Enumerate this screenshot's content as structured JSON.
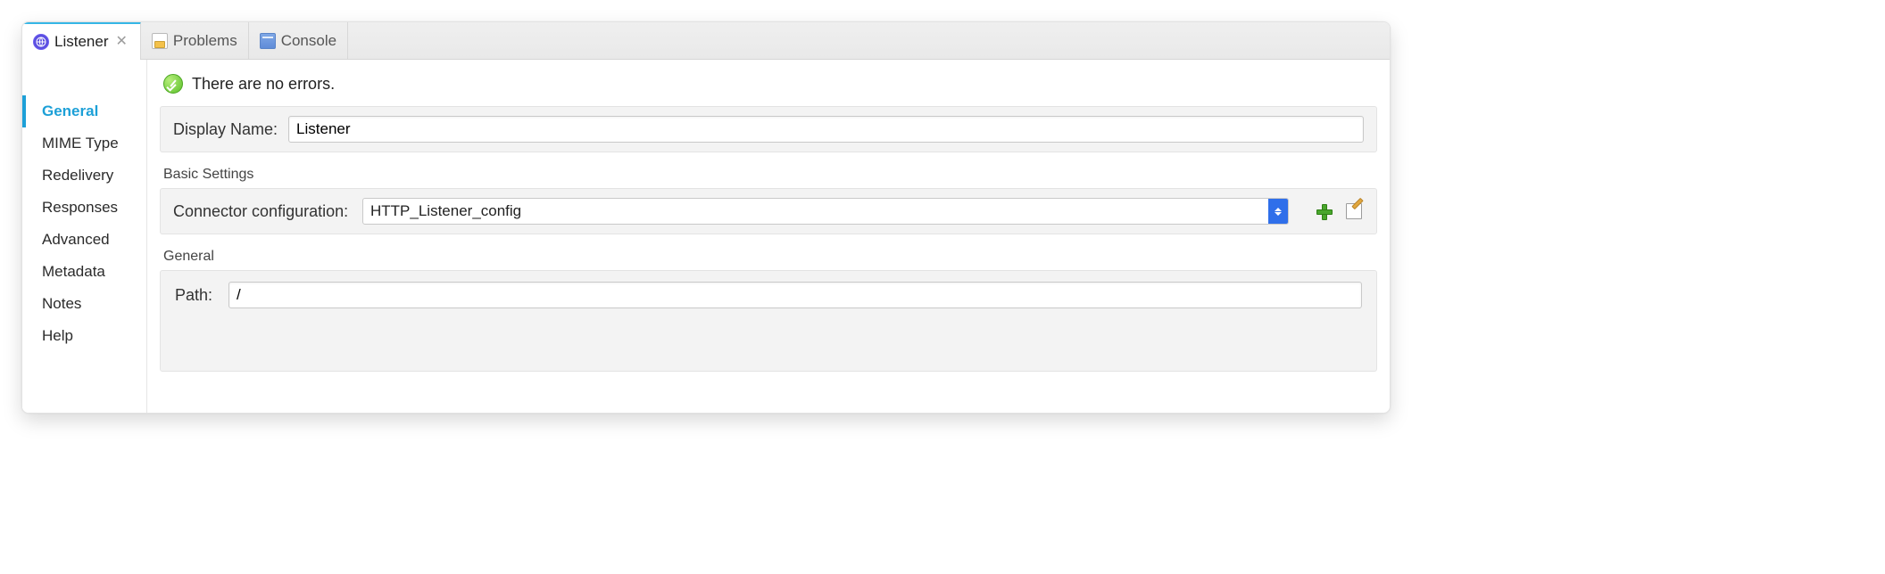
{
  "tabs": {
    "listener": {
      "label": "Listener"
    },
    "problems": {
      "label": "Problems"
    },
    "console": {
      "label": "Console"
    }
  },
  "sidebar": {
    "items": [
      {
        "id": "general",
        "label": "General",
        "active": true
      },
      {
        "id": "mime-type",
        "label": "MIME Type",
        "active": false
      },
      {
        "id": "redelivery",
        "label": "Redelivery",
        "active": false
      },
      {
        "id": "responses",
        "label": "Responses",
        "active": false
      },
      {
        "id": "advanced",
        "label": "Advanced",
        "active": false
      },
      {
        "id": "metadata",
        "label": "Metadata",
        "active": false
      },
      {
        "id": "notes",
        "label": "Notes",
        "active": false
      },
      {
        "id": "help",
        "label": "Help",
        "active": false
      }
    ]
  },
  "status": {
    "message": "There are no errors."
  },
  "form": {
    "display_name": {
      "label": "Display Name:",
      "value": "Listener"
    },
    "basic_settings": {
      "heading": "Basic Settings",
      "connector": {
        "label": "Connector configuration:",
        "value": "HTTP_Listener_config"
      }
    },
    "general": {
      "heading": "General",
      "path": {
        "label": "Path:",
        "value": "/"
      }
    }
  }
}
